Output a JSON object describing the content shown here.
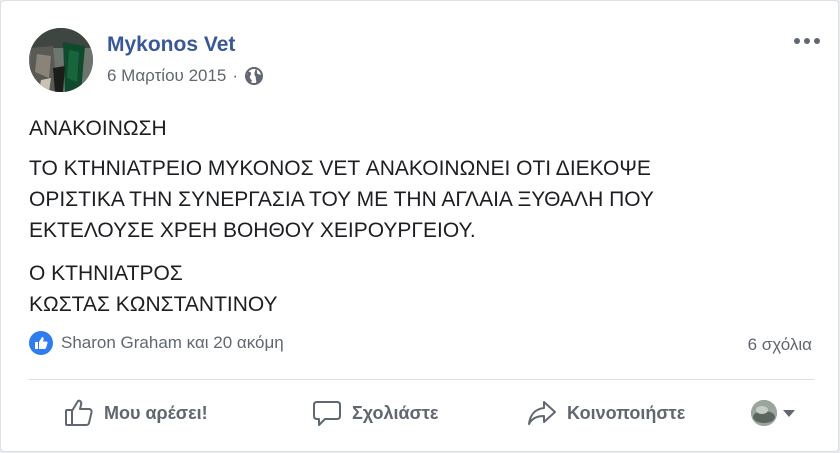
{
  "post": {
    "author": "Mykonos Vet",
    "date": "6 Μαρτίου 2015",
    "separator": "·",
    "privacy_icon": "globe-icon",
    "more_icon": "more-options-icon",
    "paragraphs": [
      "ΑΝΑΚΟΙΝΩΣΗ",
      "ΤΟ ΚΤΗΝΙΑΤΡΕΙΟ ΜΥΚΟΝΟΣ VET ΑΝΑΚΟΙΝΩΝΕΙ ΟΤΙ ΔΙΕΚΟΨΕ\nΟΡΙΣΤΙΚΑ ΤΗΝ ΣΥΝΕΡΓΑΣΙΑ ΤΟΥ ΜΕ ΤΗΝ ΑΓΛΑΙΑ ΞΥΘΑΛΗ ΠΟΥ\nΕΚΤΕΛΟΥΣΕ ΧΡΕΗ ΒΟΗΘΟΥ ΧΕΙΡΟΥΡΓΕΙΟΥ.",
      "Ο ΚΤΗΝΙΑΤΡΟΣ\nΚΩΣΤΑΣ ΚΩΝΣΤΑΝΤΙΝΟΥ"
    ]
  },
  "stats": {
    "reactions_text": "Sharon Graham και 20 ακόμη",
    "comments_text": "6 σχόλια"
  },
  "actions": {
    "like_label": "Μου αρέσει!",
    "comment_label": "Σχολιάστε",
    "share_label": "Κοινοποιήστε"
  },
  "colors": {
    "link": "#385898",
    "muted": "#616770",
    "like_blue": "#2f7cf0"
  }
}
